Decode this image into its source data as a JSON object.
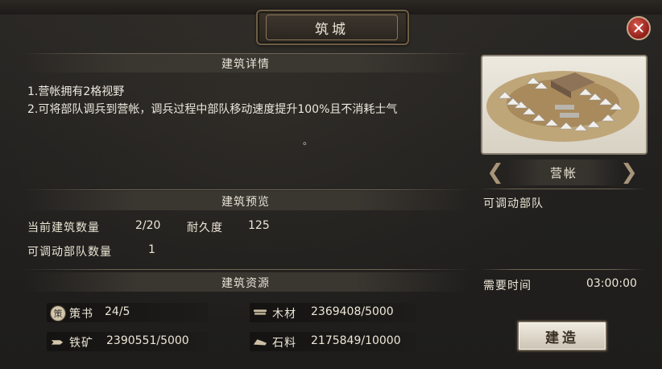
{
  "window": {
    "title": "筑城",
    "close_glyph": "✕"
  },
  "details": {
    "heading": "建筑详情",
    "lines": [
      "1.营帐拥有2格视野",
      "2.可将部队调兵到营帐，调兵过程中部队移动速度提升100%且不消耗士气"
    ],
    "trailing_mark": "。"
  },
  "preview_section": {
    "heading": "建筑预览",
    "count_label": "当前建筑数量",
    "count_value": "2/20",
    "durability_label": "耐久度",
    "durability_value": "125",
    "troops_label": "可调动部队数量",
    "troops_value": "1"
  },
  "resources": {
    "heading": "建筑资源",
    "items": [
      {
        "icon": "strategy-book-icon",
        "icon_glyph": "策",
        "name": "策书",
        "value": "24/5"
      },
      {
        "icon": "wood-icon",
        "name": "木材",
        "value": "2369408/5000"
      },
      {
        "icon": "iron-ore-icon",
        "name": "铁矿",
        "value": "2390551/5000"
      },
      {
        "icon": "stone-icon",
        "name": "石料",
        "value": "2175849/10000"
      }
    ]
  },
  "building": {
    "name": "营帐",
    "description": "可调动部队",
    "time_label": "需要时间",
    "time_value": "03:00:00",
    "build_label": "建造",
    "prev_glyph": "❮",
    "next_glyph": "❯"
  },
  "colors": {
    "accent_gold": "#8a7658",
    "close_red": "#b5322a"
  }
}
